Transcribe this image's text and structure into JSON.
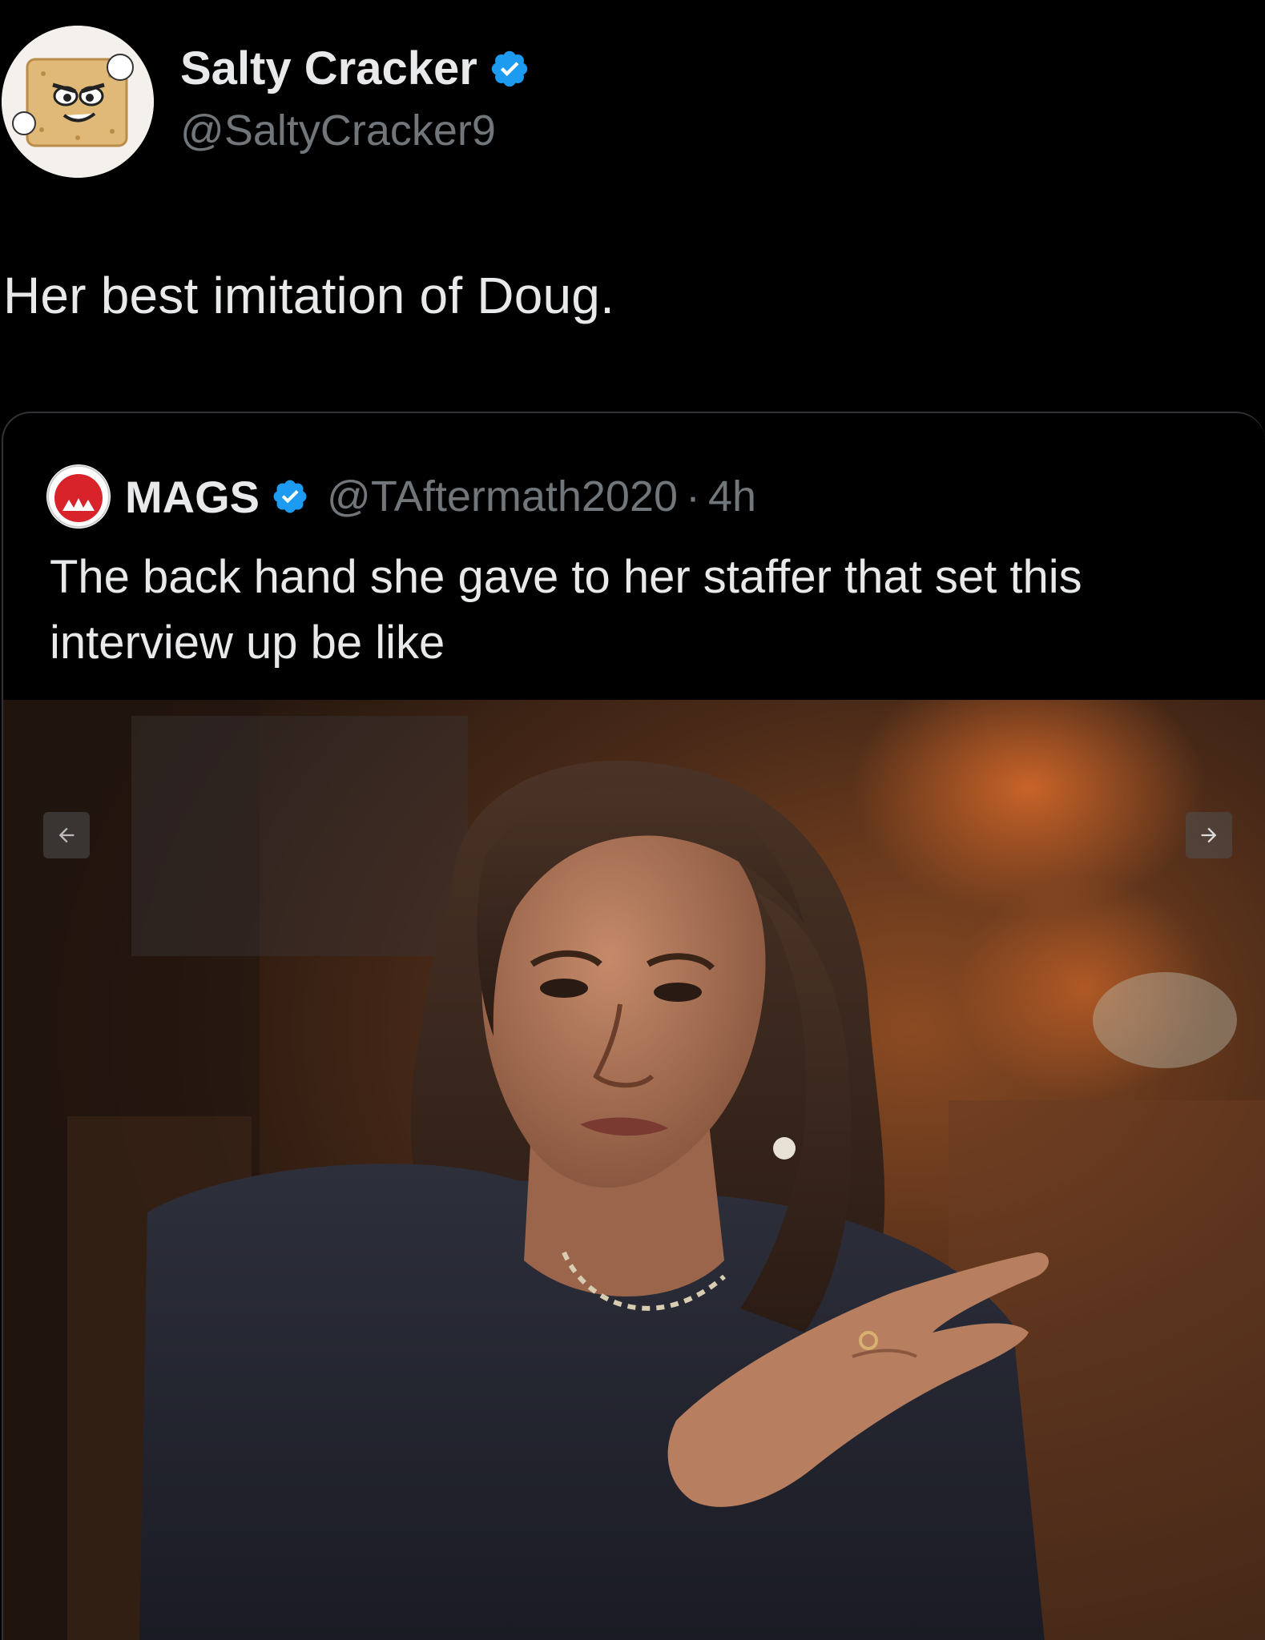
{
  "author": {
    "name": "Salty Cracker",
    "handle": "@SaltyCracker9",
    "verified": true
  },
  "tweet": {
    "text": "Her best imitation of Doug."
  },
  "quoted": {
    "name": "MAGS",
    "handle": "@TAftermath2020",
    "separator": "·",
    "time": "4h",
    "verified": true,
    "text": "The back hand she gave to her staffer that set this interview up be like"
  },
  "media": {
    "prev_icon": "arrow-left-icon",
    "next_icon": "arrow-right-icon"
  },
  "colors": {
    "background": "#000000",
    "text": "#e7e9ea",
    "secondary_text": "#71767b",
    "verified_blue": "#1d9bf0",
    "border": "#2f3336"
  }
}
